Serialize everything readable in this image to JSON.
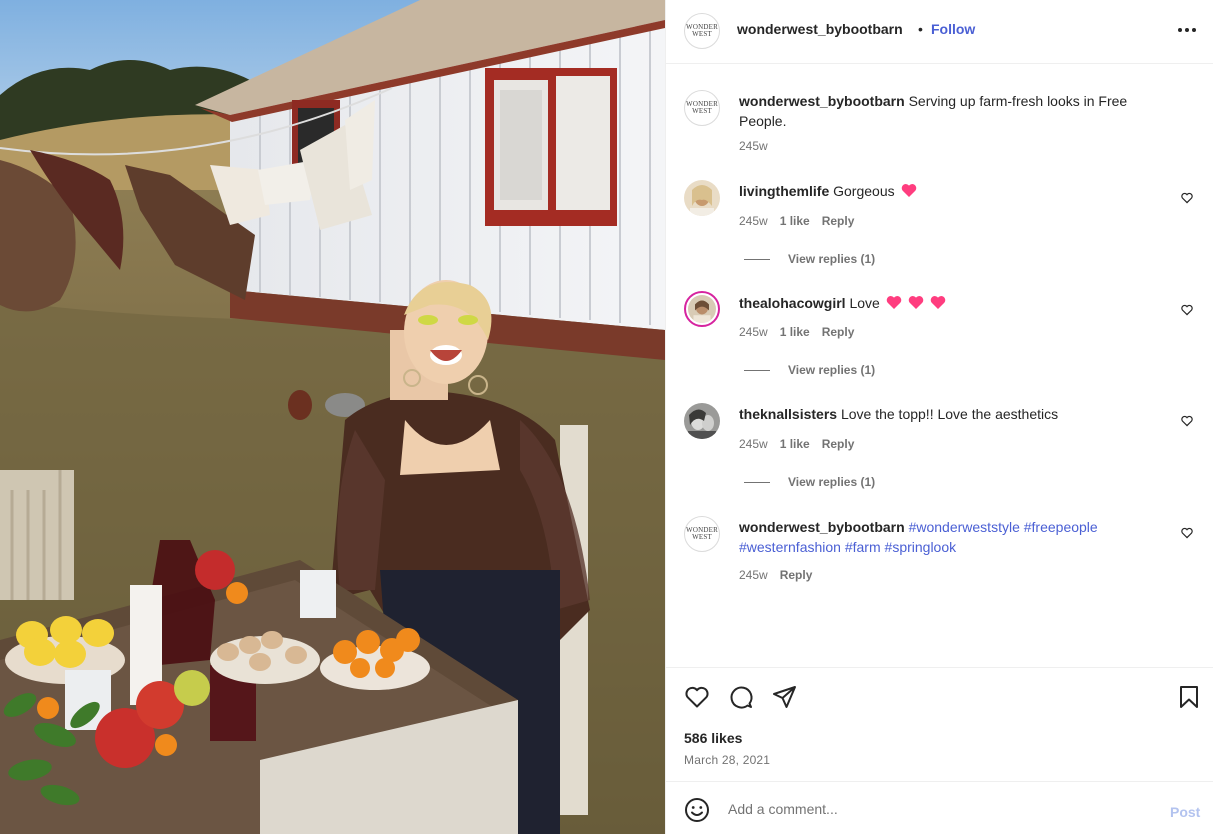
{
  "photo": {
    "alt_icon": "photo-farm-scene"
  },
  "header": {
    "username": "wonderwest_bybootbarn",
    "separator": "•",
    "follow_label": "Follow",
    "more_icon": "more-options-icon",
    "avatar_line1": "WONDER",
    "avatar_line2": "WEST"
  },
  "caption": {
    "username": "wonderwest_bybootbarn",
    "text": "Serving up farm-fresh looks in Free People.",
    "time": "245w"
  },
  "comments": [
    {
      "username": "livingthemlife",
      "text": "Gorgeous",
      "hearts": 1,
      "time": "245w",
      "likes": "1 like",
      "reply": "Reply",
      "view_replies": "View replies (1)"
    },
    {
      "username": "thealohacowgirl",
      "text": "Love",
      "hearts": 3,
      "time": "245w",
      "likes": "1 like",
      "reply": "Reply",
      "view_replies": "View replies (1)"
    },
    {
      "username": "theknallsisters",
      "text": "Love the topp!! Love the aesthetics",
      "hearts": 0,
      "time": "245w",
      "likes": "1 like",
      "reply": "Reply",
      "view_replies": "View replies (1)"
    }
  ],
  "hashtag_comment": {
    "username": "wonderwest_bybootbarn",
    "tags": [
      "#wonderweststyle",
      "#freepeople",
      "#westernfashion",
      "#farm",
      "#springlook"
    ],
    "time": "245w",
    "reply": "Reply"
  },
  "actions": {
    "like_icon": "heart-outline-icon",
    "comment_icon": "comment-bubble-icon",
    "share_icon": "share-paper-plane-icon",
    "save_icon": "bookmark-icon"
  },
  "likes": "586 likes",
  "date": "March 28, 2021",
  "add_comment": {
    "placeholder": "Add a comment...",
    "post_label": "Post",
    "emoji_icon": "emoji-smile-icon"
  },
  "colors": {
    "link": "#4a5fd4",
    "text": "#262626",
    "muted": "#737373",
    "heart": "#ff3d7f"
  }
}
